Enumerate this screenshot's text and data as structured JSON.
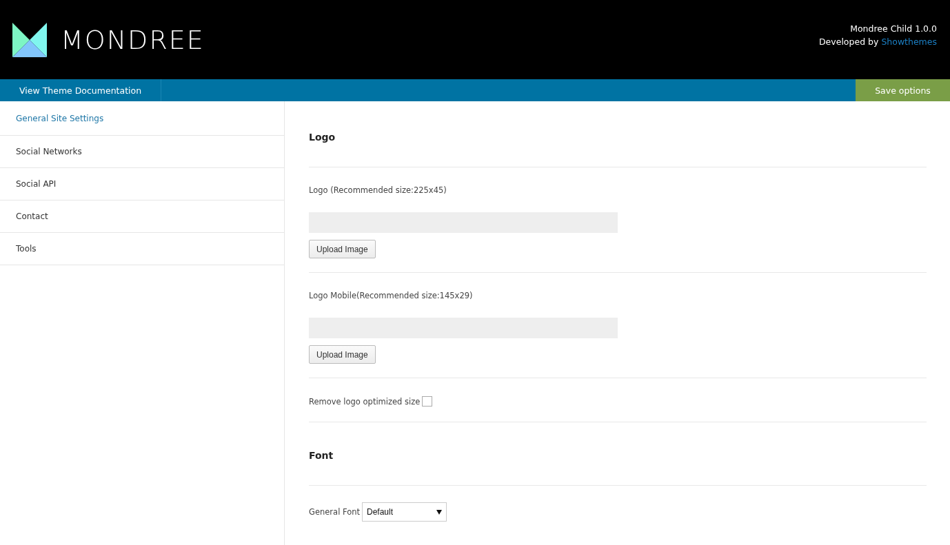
{
  "header": {
    "logo_text": "MONDREE",
    "theme_name": "Mondree Child 1.0.0",
    "developer_prefix": "Developed by",
    "developer_link": "Showthemes"
  },
  "toolbar": {
    "documentation_link": "View Theme Documentation",
    "save_button": "Save options"
  },
  "sidebar": {
    "items": [
      {
        "label": "General Site Settings",
        "selected": true
      },
      {
        "label": "Social Networks",
        "selected": false
      },
      {
        "label": "Social API",
        "selected": false
      },
      {
        "label": "Contact",
        "selected": false
      },
      {
        "label": "Tools",
        "selected": false
      }
    ]
  },
  "sections": [
    {
      "kind": "heading",
      "title": "Logo"
    },
    {
      "kind": "upload",
      "label": "Logo (Recommended size:225x45)",
      "button": "Upload Image"
    },
    {
      "kind": "upload",
      "label": "Logo Mobile(Recommended size:145x29)",
      "button": "Upload Image"
    },
    {
      "kind": "checkbox",
      "label": "Remove logo optimized size",
      "checked": false
    },
    {
      "kind": "heading",
      "title": "Font"
    },
    {
      "kind": "select",
      "label": "General Font",
      "value": "Default"
    }
  ]
}
